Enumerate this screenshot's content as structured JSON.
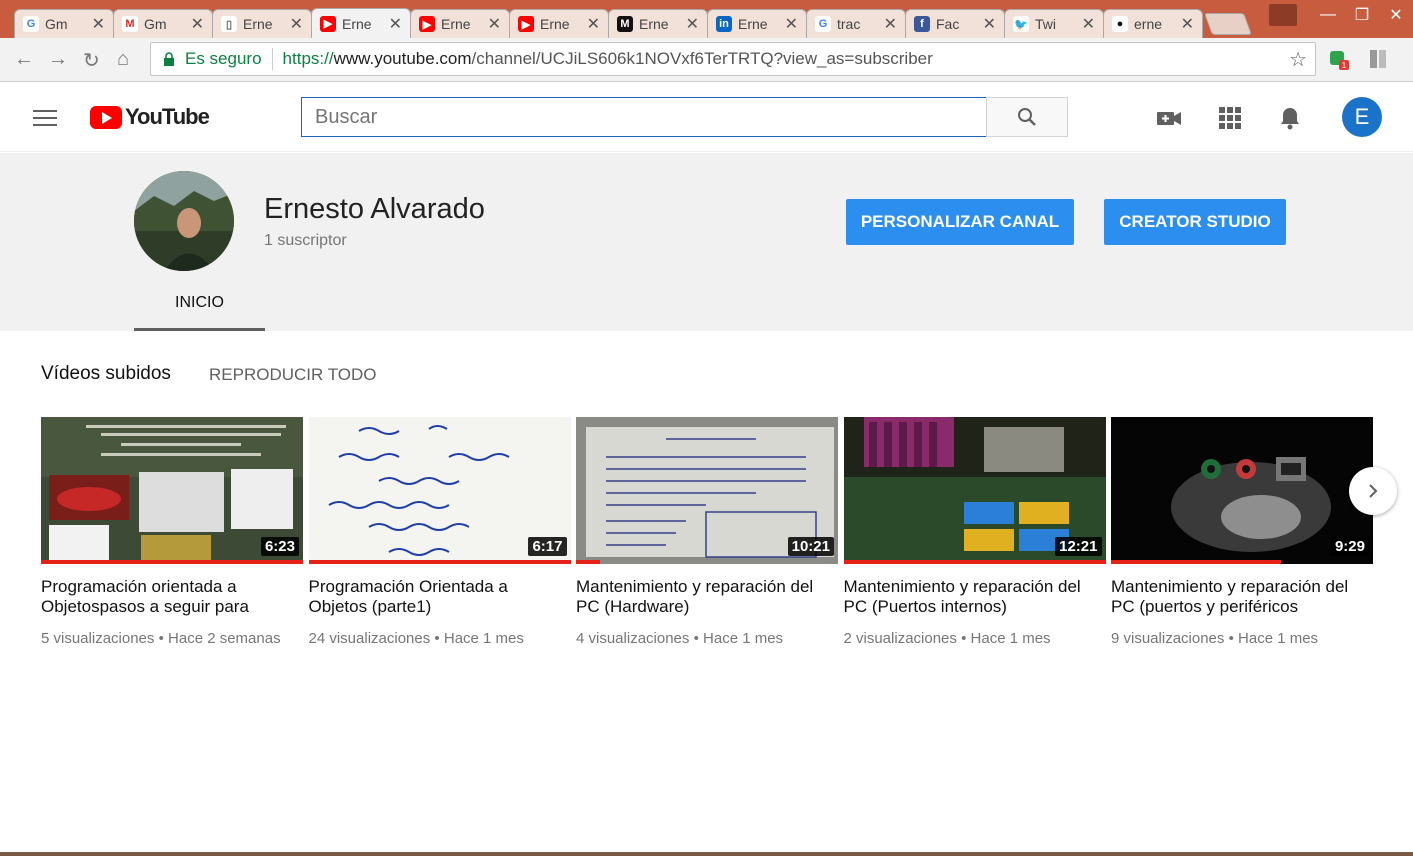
{
  "browser": {
    "tabs": [
      {
        "label": "Gm",
        "icon": "google-icon"
      },
      {
        "label": "Gm",
        "icon": "gmail-icon"
      },
      {
        "label": "Erne",
        "icon": "document-icon"
      },
      {
        "label": "Erne",
        "icon": "youtube-icon",
        "active": true
      },
      {
        "label": "Erne",
        "icon": "youtube-icon"
      },
      {
        "label": "Erne",
        "icon": "youtube-icon"
      },
      {
        "label": "Erne",
        "icon": "medium-icon"
      },
      {
        "label": "Erne",
        "icon": "linkedin-icon"
      },
      {
        "label": "trac",
        "icon": "google-icon"
      },
      {
        "label": "Fac",
        "icon": "facebook-icon"
      },
      {
        "label": "Twi",
        "icon": "twitter-icon"
      },
      {
        "label": "erne",
        "icon": "github-icon"
      }
    ],
    "secure_label": "Es seguro",
    "url_scheme": "https://",
    "url_host": "www.youtube.com",
    "url_path": "/channel/UCJiLS606k1NOVxf6TerTRTQ?view_as=subscriber",
    "extension_badge": "1"
  },
  "header": {
    "logo_text": "YouTube",
    "search_placeholder": "Buscar",
    "avatar_letter": "E"
  },
  "channel": {
    "name": "Ernesto Alvarado",
    "subscribers": "1 suscriptor",
    "customize_button": "PERSONALIZAR CANAL",
    "studio_button": "CREATOR STUDIO",
    "tab_home": "INICIO"
  },
  "section": {
    "title": "Vídeos subidos",
    "play_all": "REPRODUCIR TODO"
  },
  "videos": [
    {
      "title": "Programación orientada a Objetospasos a seguir para",
      "duration": "6:23",
      "views": "5 visualizaciones",
      "age": "Hace 2 semanas",
      "watched": 1.0
    },
    {
      "title": "Programación Orientada a Objetos (parte1)",
      "duration": "6:17",
      "views": "24 visualizaciones",
      "age": "Hace 1 mes",
      "watched": 1.0
    },
    {
      "title": "Mantenimiento y reparación del PC (Hardware)",
      "duration": "10:21",
      "views": "4 visualizaciones",
      "age": "Hace 1 mes",
      "watched": 0.09
    },
    {
      "title": "Mantenimiento y reparación del PC (Puertos internos)",
      "duration": "12:21",
      "views": "2 visualizaciones",
      "age": "Hace 1 mes",
      "watched": 1.0
    },
    {
      "title": "Mantenimiento y reparación del PC (puertos y periféricos",
      "duration": "9:29",
      "views": "9 visualizaciones",
      "age": "Hace 1 mes",
      "watched": 0.65
    }
  ],
  "meta_separator": "•",
  "colors": {
    "youtube_red": "#ff0000",
    "button_blue": "#2c8ff0",
    "secure_green": "#0b8043",
    "chrome_frame": "#c75c3f"
  }
}
